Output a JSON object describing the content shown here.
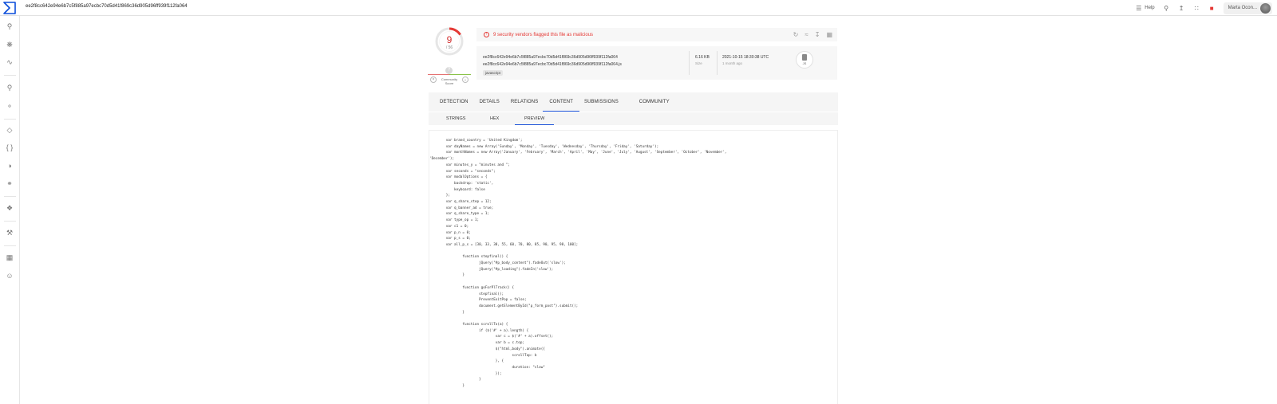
{
  "header": {
    "hash": "ee2f8cc642e94e6b7c5f885a97ecbc70d5d41f869c36d905d96ff939f112fa064",
    "help_label": "Help",
    "user_name": "Marta Ocon..."
  },
  "colors": {
    "accent": "#1a50d8",
    "malicious": "#e53935",
    "brand": "#0b4dda"
  },
  "detection": {
    "detected": "9",
    "total": "/ 56",
    "community_label": "Community Score",
    "community_value": "?"
  },
  "alert": {
    "text": "9 security vendors flagged this file as malicious"
  },
  "file": {
    "hash_line1": "ee2f8cc642e94e6b7c5f885a97ecbc70d5d41f869c36d905d96ff939f112fa064",
    "hash_line2": "ee2f8cc642e94e6b7c5f885a97ecbc70d5d41f869c36d905d96ff939f112fa064.js",
    "tag": "javascript",
    "size": "6.16 KB",
    "size_label": "Size",
    "date": "2021-10-15 18:30:38 UTC",
    "date_ago": "1 month ago",
    "type_label": "JS"
  },
  "tabs": [
    {
      "label": "DETECTION"
    },
    {
      "label": "DETAILS"
    },
    {
      "label": "RELATIONS"
    },
    {
      "label": "CONTENT"
    },
    {
      "label": "SUBMISSIONS"
    },
    {
      "label": "COMMUNITY"
    }
  ],
  "subtabs": [
    {
      "label": "STRINGS"
    },
    {
      "label": "HEX"
    },
    {
      "label": "PREVIEW"
    }
  ],
  "code_lines": [
    "        var brand_country = 'United Kingdom';",
    "        var dayNames = new Array('Sunday', 'Monday', 'Tuesday', 'Wednesday', 'Thursday', 'Friday', 'Saturday');",
    "        var monthNames = new Array('January', 'February', 'March', 'April', 'May', 'June', 'July', 'August', 'September', 'October', 'November',",
    "'December');",
    "        var minutes_y = \"minutes and \";",
    "        var seconds = \"seconds\";",
    "        var modalOptions = {",
    "            backdrop: 'static',",
    "            keyboard: false",
    "        };",
    "        var q_share_step = 12;",
    "        var q_banner_ad = true;",
    "        var q_share_type = 1;",
    "        var type_op = 1;",
    "        var c1 = 0;",
    "        var p_n = 0;",
    "        var p_s = 0;",
    "        var all_p_s = [30, 33, 38, 55, 60, 70, 80, 85, 90, 95, 98, 100];",
    "",
    "                function stepfinal() {",
    "                        jQuery(\"#p_body_content\").fadeOut('slow');",
    "                        jQuery(\"#p_loading\").fadeIn('slow');",
    "                }",
    "",
    "                function goForPlTrack() {",
    "                        stepfinal();",
    "                        PreventExitPop = false;",
    "                        document.getElementById(\"p_form_post\").submit();",
    "                }",
    "",
    "                function scrollTo(a) {",
    "                        if ($('#' + a).length) {",
    "                                var c = $('#' + a).offset();",
    "                                var b = c.top;",
    "                                $(\"html,body\").animate({",
    "                                        scrollTop: b",
    "                                }, {",
    "                                        duration: \"slow\"",
    "                                });",
    "                        }",
    "                }"
  ]
}
